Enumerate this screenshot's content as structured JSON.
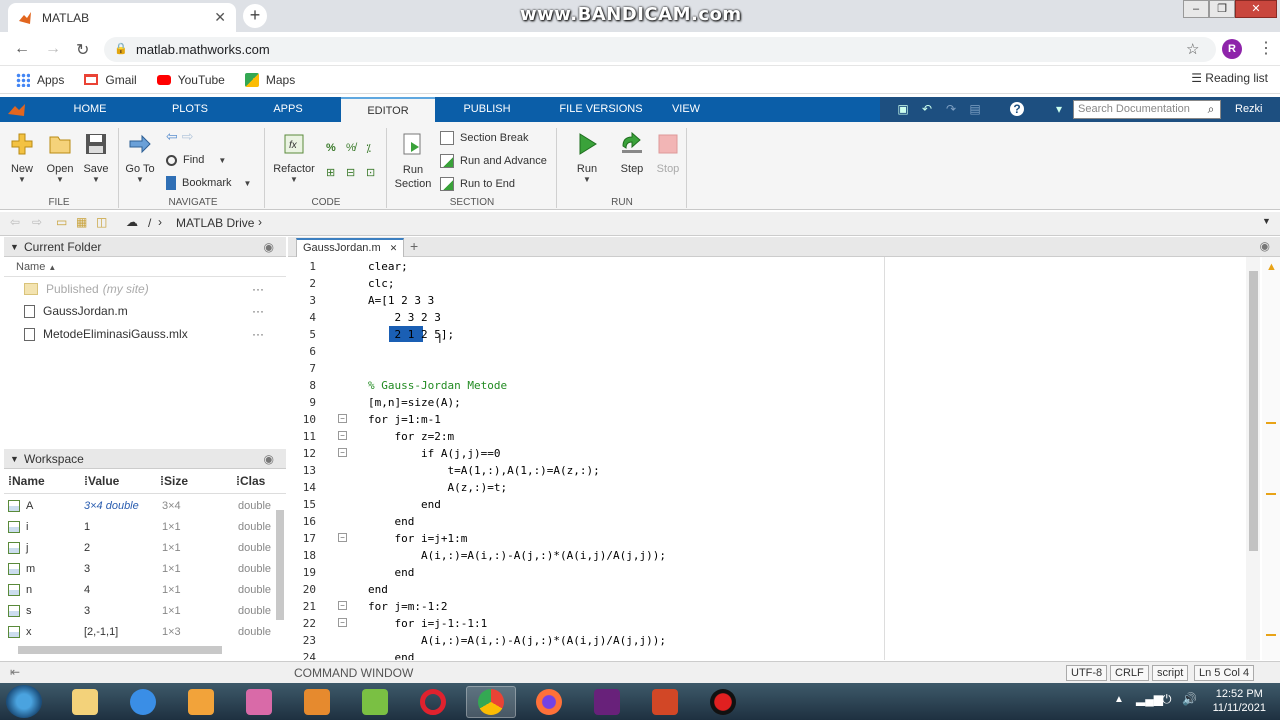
{
  "browser": {
    "tab_title": "MATLAB",
    "watermark": "www.BANDICAM.com",
    "url": "matlab.mathworks.com",
    "profile_initial": "R",
    "bookmarks": [
      "Apps",
      "Gmail",
      "YouTube",
      "Maps"
    ],
    "reading_list": "Reading list"
  },
  "toolstrip_tabs": [
    "HOME",
    "PLOTS",
    "APPS",
    "EDITOR",
    "PUBLISH",
    "FILE VERSIONS",
    "VIEW"
  ],
  "search_placeholder": "Search Documentation",
  "user_name": "Rezki",
  "toolstrip": {
    "file": {
      "label": "FILE",
      "new": "New",
      "open": "Open",
      "save": "Save"
    },
    "navigate": {
      "label": "NAVIGATE",
      "goto": "Go To",
      "find": "Find",
      "bookmark": "Bookmark"
    },
    "code": {
      "label": "CODE",
      "refactor": "Refactor"
    },
    "section": {
      "label": "SECTION",
      "run_section": "Run Section",
      "section_break": "Section Break",
      "run_advance": "Run and Advance",
      "run_end": "Run to End"
    },
    "run": {
      "label": "RUN",
      "run": "Run",
      "step": "Step",
      "stop": "Stop"
    }
  },
  "path": {
    "sep": "/",
    "drive": "MATLAB Drive"
  },
  "current_folder": {
    "title": "Current Folder",
    "col_name": "Name",
    "items": [
      {
        "name": "Published",
        "note": "(my site)",
        "more": "···"
      },
      {
        "name": "GaussJordan.m",
        "more": "···"
      },
      {
        "name": "MetodeEliminasiGauss.mlx",
        "more": "···"
      }
    ]
  },
  "workspace": {
    "title": "Workspace",
    "cols": [
      "Name",
      "Value",
      "Size",
      "Clas"
    ],
    "rows": [
      {
        "name": "A",
        "value": "3×4 double",
        "size": "3×4",
        "cls": "double"
      },
      {
        "name": "i",
        "value": "1",
        "size": "1×1",
        "cls": "double"
      },
      {
        "name": "j",
        "value": "2",
        "size": "1×1",
        "cls": "double"
      },
      {
        "name": "m",
        "value": "3",
        "size": "1×1",
        "cls": "double"
      },
      {
        "name": "n",
        "value": "4",
        "size": "1×1",
        "cls": "double"
      },
      {
        "name": "s",
        "value": "3",
        "size": "1×1",
        "cls": "double"
      },
      {
        "name": "x",
        "value": "[2,-1,1]",
        "size": "1×3",
        "cls": "double"
      }
    ]
  },
  "editor": {
    "tab": "GaussJordan.m",
    "line_numbers": [
      "1",
      "2",
      "3",
      "4",
      "5",
      "6",
      "7",
      "8",
      "9",
      "10",
      "11",
      "12",
      "13",
      "14",
      "15",
      "16",
      "17",
      "18",
      "19",
      "20",
      "21",
      "22",
      "23",
      "24"
    ],
    "lines": [
      "clear;",
      "clc;",
      "A=[1 2 3 3",
      "    2 3 2 3",
      "    2 1 2 5];",
      "",
      "",
      "% Gauss-Jordan Metode",
      "[m,n]=size(A);",
      "for j=1:m-1",
      "    for z=2:m",
      "        if A(j,j)==0",
      "            t=A(1,:),A(1,:)=A(z,:);",
      "            A(z,:)=t;",
      "        end",
      "    end",
      "    for i=j+1:m",
      "        A(i,:)=A(i,:)-A(j,:)*(A(i,j)/A(j,j));",
      "    end",
      "end",
      "for j=m:-1:2",
      "    for i=j-1:-1:1",
      "        A(i,:)=A(i,:)-A(j,:)*(A(i,j)/A(j,j));",
      "    end"
    ]
  },
  "status": {
    "command_window": "COMMAND WINDOW",
    "encoding": "UTF-8",
    "line_ending": "CRLF",
    "type": "script",
    "position": "Ln 5 Col 4"
  },
  "taskbar": {
    "time": "12:52 PM",
    "date": "11/11/2021"
  }
}
